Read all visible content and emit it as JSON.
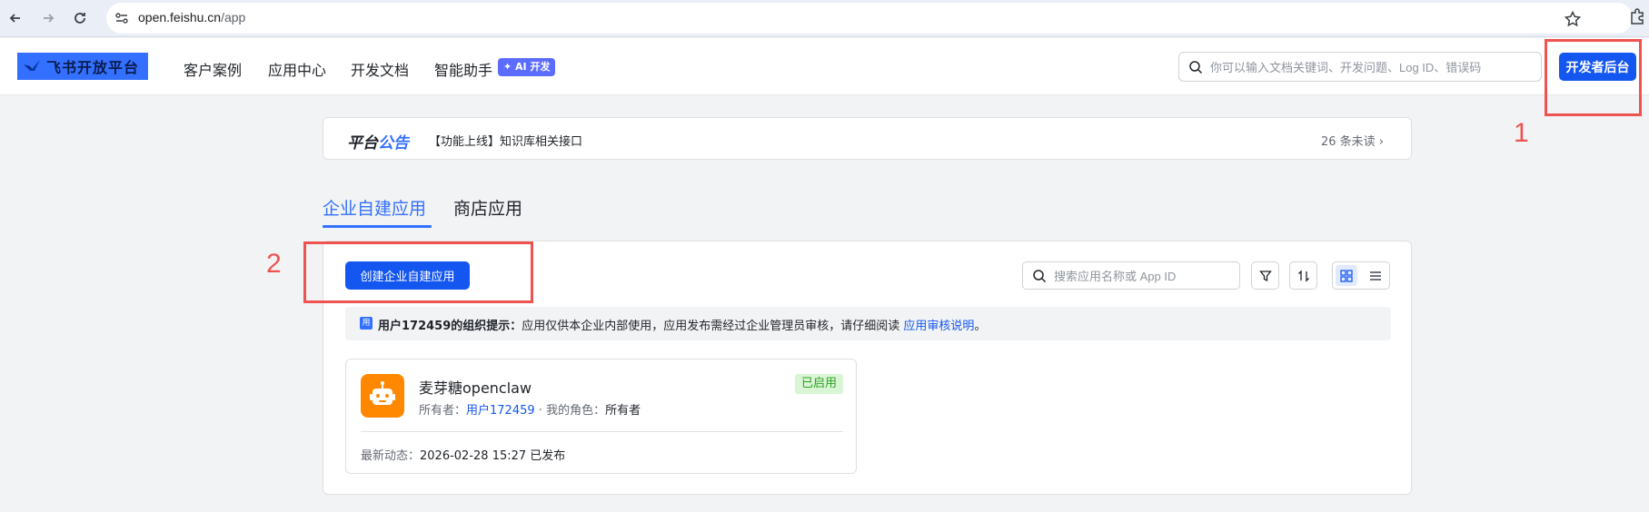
{
  "browser": {
    "url_host": "open.feishu.cn",
    "url_path": "/app"
  },
  "header": {
    "logo_text": "飞书开放平台",
    "nav": [
      "客户案例",
      "应用中心",
      "开发文档",
      "智能助手"
    ],
    "ai_tag": "✦ AI 开发",
    "search_placeholder": "你可以输入文档关键词、开发问题、Log ID、错误码",
    "dev_console_label": "开发者后台"
  },
  "annotations": {
    "label_1": "1",
    "label_2": "2"
  },
  "announcement": {
    "title_main": "平台",
    "title_accent": "公告",
    "text": "【功能上线】知识库相关接口",
    "unread": "26 条未读 ›"
  },
  "tabs": [
    {
      "label": "企业自建应用",
      "active": true
    },
    {
      "label": "商店应用",
      "active": false
    }
  ],
  "panel": {
    "create_label": "创建企业自建应用",
    "search_placeholder": "搜索应用名称或 App ID",
    "notice_icon": "用",
    "notice_bold": "用户172459的组织提示：",
    "notice_text": "应用仅供本企业内部使用，应用发布需经过企业管理员审核，请仔细阅读 ",
    "notice_link": "应用审核说明",
    "notice_end": "。"
  },
  "apps": [
    {
      "name": "麦芽糖openclaw",
      "owner_label": "所有者：",
      "owner": "用户172459",
      "role_label": "我的角色：",
      "role": "所有者",
      "status": "已启用",
      "activity_label": "最新动态：",
      "activity": "2026-02-28 15:27 已发布"
    }
  ],
  "colors": {
    "primary": "#1456f0",
    "accent": "#3370ff",
    "annotation": "#ef5350",
    "status_green": "#2ea121"
  }
}
